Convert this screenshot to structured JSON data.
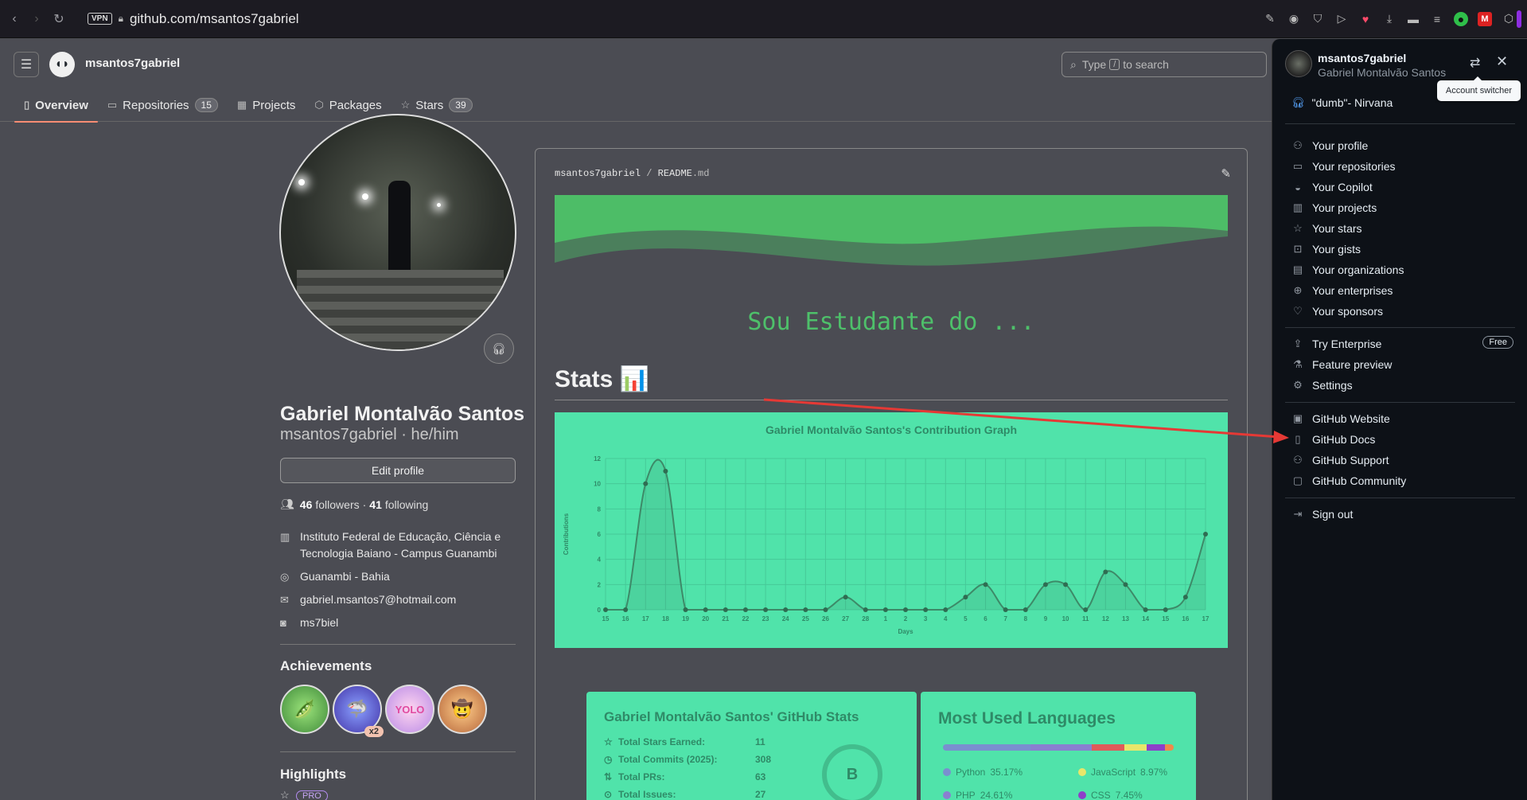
{
  "browser": {
    "url": "github.com/msantos7gabriel",
    "vpn_label": "VPN"
  },
  "header": {
    "username": "msantos7gabriel",
    "search_prefix": "Type",
    "search_key": "/",
    "search_suffix": "to search",
    "tabs": [
      {
        "label": "Overview",
        "icon": "book-icon",
        "count": ""
      },
      {
        "label": "Repositories",
        "icon": "repo-icon",
        "count": "15"
      },
      {
        "label": "Projects",
        "icon": "table-icon",
        "count": ""
      },
      {
        "label": "Packages",
        "icon": "package-icon",
        "count": ""
      },
      {
        "label": "Stars",
        "icon": "star-icon",
        "count": "39"
      }
    ]
  },
  "profile": {
    "name": "Gabriel Montalvão Santos",
    "login_pronouns": "msantos7gabriel · he/him",
    "edit_label": "Edit profile",
    "followers_count": "46",
    "followers_label": "followers",
    "following_count": "41",
    "following_label": "following",
    "organization": "Instituto Federal de Educação, Ciência e Tecnologia Baiano - Campus Guanambi",
    "location": "Guanambi - Bahia",
    "email": "gabriel.msantos7@hotmail.com",
    "social": "ms7biel",
    "achievements_title": "Achievements",
    "achievement_multiplier": "x2",
    "highlights_title": "Highlights",
    "pro_label": "PRO"
  },
  "readme": {
    "path_owner": "msantos7gabriel",
    "path_sep": "/",
    "path_file": "README",
    "path_ext": ".md",
    "typing_text": "Sou Estudante do ...",
    "stats_heading": "Stats 📊"
  },
  "chart_data": {
    "type": "area",
    "title": "Gabriel Montalvão Santos's Contribution Graph",
    "xlabel": "Days",
    "ylabel": "Contributions",
    "ylim": [
      0,
      12
    ],
    "yticks": [
      0,
      2,
      4,
      6,
      8,
      10,
      12
    ],
    "categories": [
      "15",
      "16",
      "17",
      "18",
      "19",
      "20",
      "21",
      "22",
      "23",
      "24",
      "25",
      "26",
      "27",
      "28",
      "1",
      "2",
      "3",
      "4",
      "5",
      "6",
      "7",
      "8",
      "9",
      "10",
      "11",
      "12",
      "13",
      "14",
      "15",
      "16",
      "17"
    ],
    "values": [
      0,
      0,
      10,
      11,
      0,
      0,
      0,
      0,
      0,
      0,
      0,
      0,
      1,
      0,
      0,
      0,
      0,
      0,
      1,
      2,
      0,
      0,
      2,
      2,
      0,
      3,
      2,
      0,
      0,
      1,
      6
    ],
    "colors": {
      "background": "#50e3aa",
      "line": "#3d8a68",
      "text": "#2f8a67"
    }
  },
  "stats_card": {
    "title": "Gabriel Montalvão Santos' GitHub Stats",
    "rows": [
      {
        "label": "Total Stars Earned:",
        "value": "11",
        "icon": "star-icon"
      },
      {
        "label": "Total Commits (2025):",
        "value": "308",
        "icon": "history-icon"
      },
      {
        "label": "Total PRs:",
        "value": "63",
        "icon": "pr-icon"
      },
      {
        "label": "Total Issues:",
        "value": "27",
        "icon": "issue-icon"
      }
    ],
    "grade": "B"
  },
  "langs_card": {
    "title": "Most Used Languages",
    "items": [
      {
        "name": "Python",
        "pct": "35.17%",
        "color": "#7a8fcf",
        "share": 35.17
      },
      {
        "name": "JavaScript",
        "pct": "8.97%",
        "color": "#e8e66a",
        "share": 8.97
      },
      {
        "name": "PHP",
        "pct": "24.61%",
        "color": "#8a7fd0",
        "share": 24.61
      },
      {
        "name": "CSS",
        "pct": "7.45%",
        "color": "#8e3fc9",
        "share": 7.45
      }
    ],
    "bar_other": [
      {
        "color": "#e05a5a",
        "share": 13.0
      },
      {
        "color": "#f08a4b",
        "share": 3.5
      }
    ]
  },
  "dropdown": {
    "login": "msantos7gabriel",
    "full_name": "Gabriel Montalvão Santos",
    "tooltip": "Account switcher",
    "status": "\"dumb\"- Nirvana",
    "group1": [
      {
        "label": "Your profile",
        "icon": "person-icon"
      },
      {
        "label": "Your repositories",
        "icon": "repo-icon"
      },
      {
        "label": "Your Copilot",
        "icon": "copilot-icon"
      },
      {
        "label": "Your projects",
        "icon": "project-icon"
      },
      {
        "label": "Your stars",
        "icon": "star-icon"
      },
      {
        "label": "Your gists",
        "icon": "code-square-icon"
      },
      {
        "label": "Your organizations",
        "icon": "organization-icon"
      },
      {
        "label": "Your enterprises",
        "icon": "globe-icon"
      },
      {
        "label": "Your sponsors",
        "icon": "heart-icon"
      }
    ],
    "group2": [
      {
        "label": "Try Enterprise",
        "icon": "upload-icon",
        "pill": "Free"
      },
      {
        "label": "Feature preview",
        "icon": "beaker-icon",
        "pill": ""
      },
      {
        "label": "Settings",
        "icon": "gear-icon",
        "pill": ""
      }
    ],
    "group3": [
      {
        "label": "GitHub Website",
        "icon": "browser-icon"
      },
      {
        "label": "GitHub Docs",
        "icon": "book-icon"
      },
      {
        "label": "GitHub Support",
        "icon": "people-icon"
      },
      {
        "label": "GitHub Community",
        "icon": "comment-icon"
      }
    ],
    "sign_out": "Sign out"
  }
}
